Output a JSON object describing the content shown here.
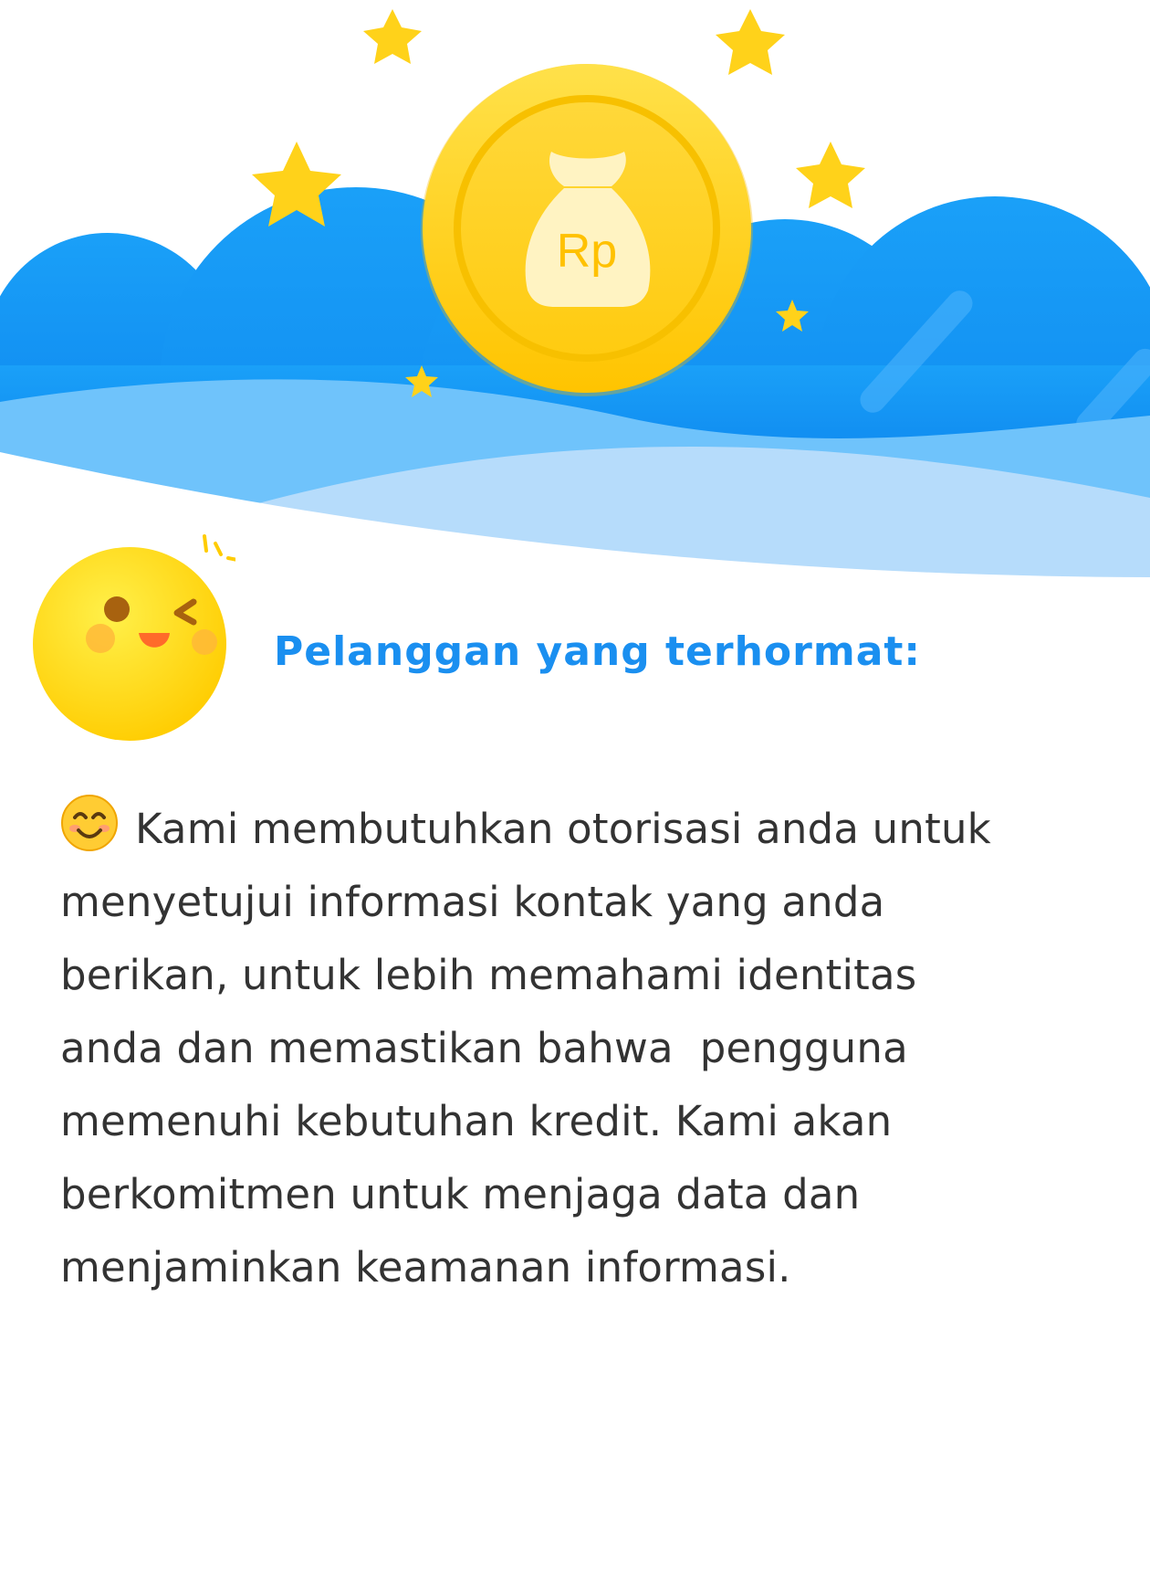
{
  "hero": {
    "currency_symbol": "Rp",
    "colors": {
      "cloud_dark": "#1190f0",
      "cloud_light": "#6fc3fb",
      "wave_pale": "#b6dcfb",
      "coin": "#ffd21f",
      "star": "#ffd21a"
    }
  },
  "greeting": {
    "text": "Pelanggan yang terhormat:"
  },
  "message": {
    "lines": [
      "Kami membutuhkan otorisasi anda untuk",
      "menyetujui informasi kontak yang anda",
      "berikan, untuk lebih memahami identitas",
      "anda dan memastikan bahwa  pengguna",
      "memenuhi kebutuhan kredit. Kami akan",
      "berkomitmen untuk menjaga data dan",
      "menjaminkan keamanan informasi."
    ]
  }
}
